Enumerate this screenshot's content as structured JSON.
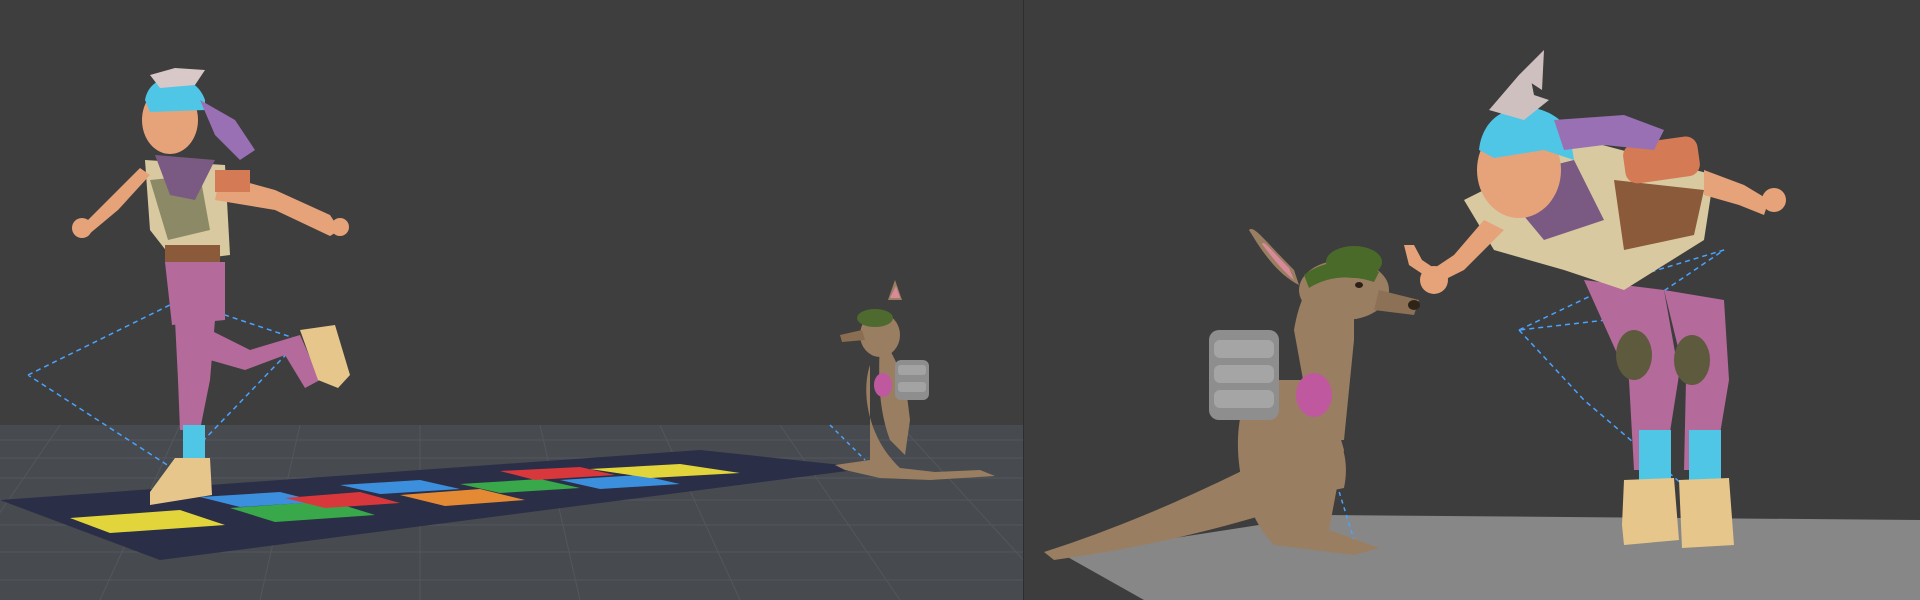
{
  "viewports": [
    {
      "id": "viewport-left",
      "scene": "hopscotch",
      "description_visible_text": []
    },
    {
      "id": "viewport-right",
      "scene": "girl-and-kangaroo-close",
      "description_visible_text": []
    }
  ],
  "colors": {
    "viewport_background": "#3e3e3e",
    "grid_floor": "#4a4d52",
    "grid_line": "#5a5f66",
    "hopscotch_mat": "#2a2d45",
    "tile_yellow": "#e3d53c",
    "tile_blue": "#3b8fdc",
    "tile_red": "#d8383c",
    "tile_green": "#38a94a",
    "tile_orange": "#e58a34",
    "ground_plane": "#8a8a8a",
    "ik_handle": "#4aa3ff",
    "hair_blue": "#4fc6e6",
    "skin": "#e6a37a",
    "pants_purple": "#b46a9a",
    "shirt_tan": "#d9c9a0",
    "kangaroo_brown": "#9a7e62",
    "backpack_grey": "#8e8e8e"
  },
  "icons": [
    "camera-icon"
  ]
}
